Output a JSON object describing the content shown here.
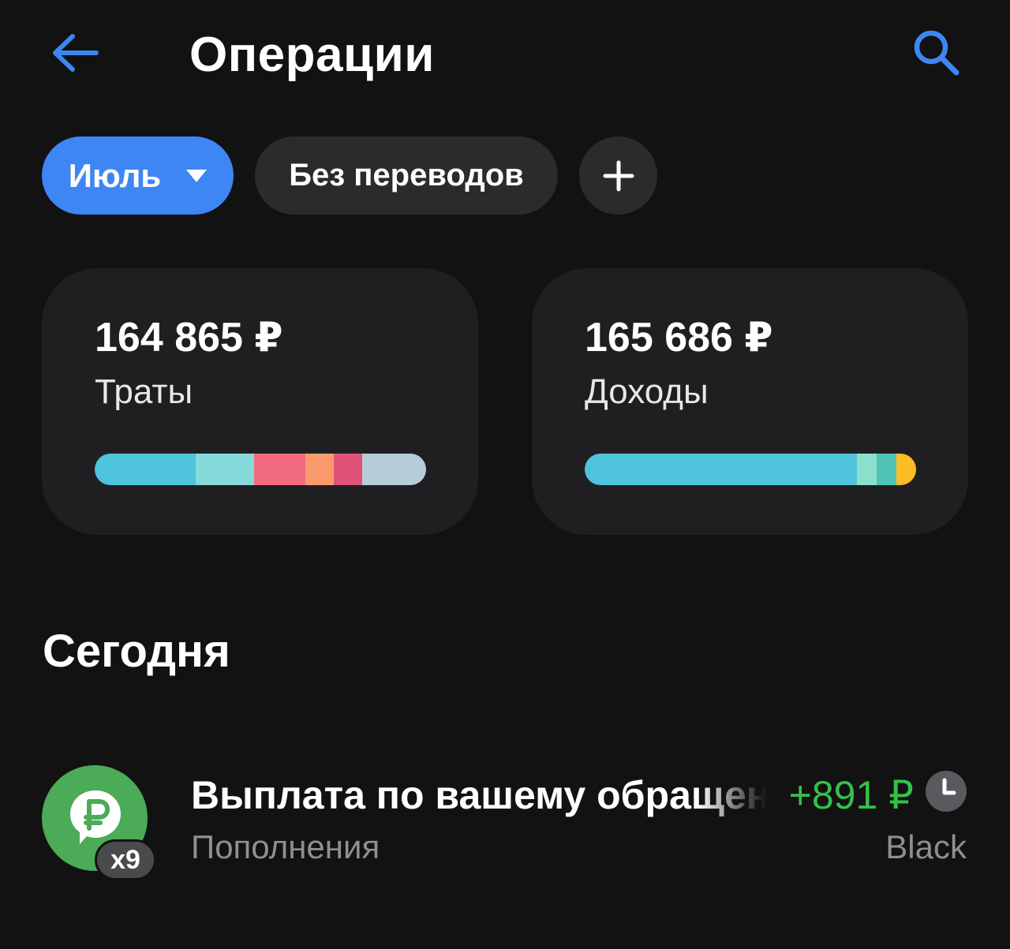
{
  "header": {
    "title": "Операции"
  },
  "chips": {
    "month_label": "Июль",
    "filter_label": "Без переводов"
  },
  "summary": {
    "expenses": {
      "amount": "164 865 ₽",
      "label": "Траты",
      "segments": [
        {
          "share": 0.305,
          "color": "#4fc3dc"
        },
        {
          "share": 0.176,
          "color": "#86dad9"
        },
        {
          "share": 0.155,
          "color": "#f26b81"
        },
        {
          "share": 0.086,
          "color": "#fb9b6d"
        },
        {
          "share": 0.086,
          "color": "#e0527a"
        },
        {
          "share": 0.192,
          "color": "#b6cdda"
        }
      ]
    },
    "income": {
      "amount": "165 686 ₽",
      "label": "Доходы",
      "segments": [
        {
          "share": 0.821,
          "color": "#4fc3dc"
        },
        {
          "share": 0.06,
          "color": "#8be0cc"
        },
        {
          "share": 0.059,
          "color": "#4fc3b5"
        },
        {
          "share": 0.06,
          "color": "#fbbd23"
        }
      ]
    }
  },
  "section": {
    "title": "Сегодня"
  },
  "operations": [
    {
      "title": "Выплата по вашему обращению",
      "category": "Пополнения",
      "amount": "+891 ₽",
      "account": "Black",
      "badge": "x9",
      "icon": "ruble-bubble-icon",
      "icon_color": "#4bab57"
    }
  ],
  "colors": {
    "accent": "#3d86f4",
    "background": "#121212",
    "card": "#1f1f21",
    "positive": "#35c04a",
    "muted": "#8e8e93"
  }
}
